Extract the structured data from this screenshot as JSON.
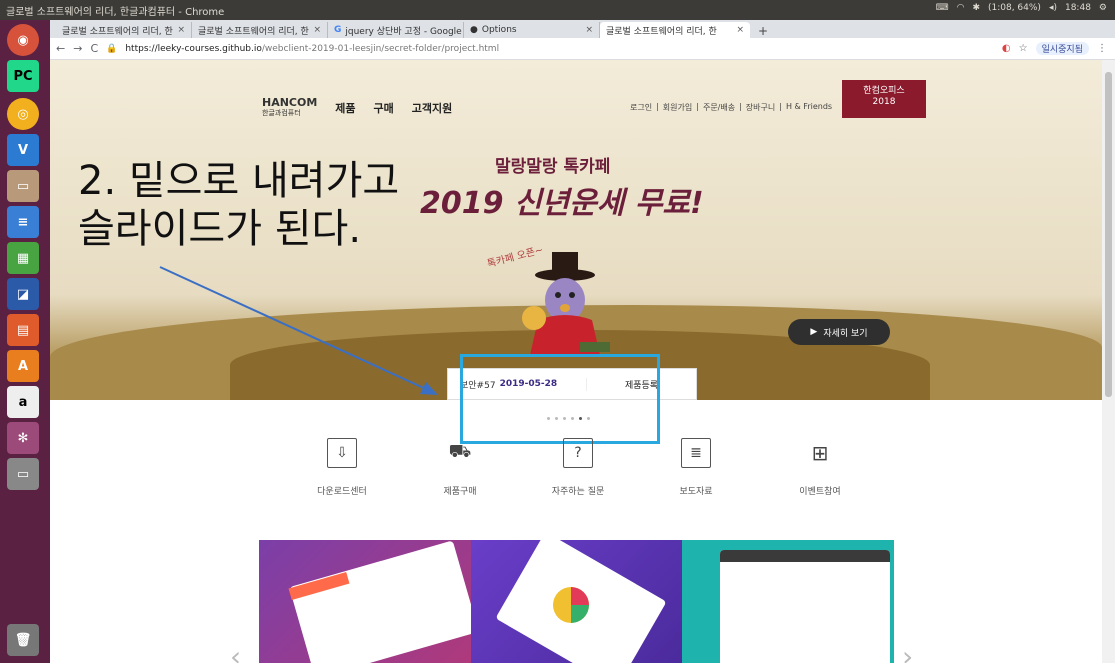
{
  "window_title": "글로벌 소프트웨어의 리더, 한글과컴퓨터 - Chrome",
  "system_status": "(1:08, 64%)",
  "clock": "18:48",
  "launcher_items": [
    "ubuntu-logo",
    "pycharm",
    "chrome",
    "vscode",
    "files",
    "writer",
    "calc",
    "photos",
    "impress",
    "software-center",
    "amazon",
    "settings",
    "drive",
    "trash"
  ],
  "tabs": [
    {
      "label": "글로벌 소프트웨어의 리더, 한",
      "active": false
    },
    {
      "label": "글로벌 소프트웨어의 리더, 한",
      "active": false
    },
    {
      "label": "jquery 상단바 고정 - Google",
      "active": false
    },
    {
      "label": "Options",
      "active": false
    },
    {
      "label": "글로벌 소프트웨어의 리더, 한",
      "active": true
    }
  ],
  "new_tab": "+",
  "url": {
    "host": "https://leeky-courses.github.io",
    "path": "/webclient-2019-01-leesjin/secret-folder/project.html"
  },
  "user_chip": "일시중지됨",
  "site": {
    "logo": "HANCOM",
    "logo_sub": "한글과컴퓨터",
    "nav": [
      "제품",
      "구매",
      "고객지원"
    ],
    "util": [
      "로그인",
      "회원가입",
      "주문/배송",
      "장바구니",
      "H & Friends"
    ],
    "hanoffice_line1": "한컴오피스",
    "hanoffice_line2": "2018"
  },
  "hero": {
    "promo_small": "말랑말랑 톡카페",
    "promo_big": "2019 신년운세 무료!",
    "promo_tag": "톡카페 오픈~",
    "detail_button": "자세히 보기",
    "detail_icon": "play-icon"
  },
  "reg_box": {
    "security": "보안#57",
    "date": "2019-05-28",
    "register": "제품등록"
  },
  "slide_dots": {
    "count": 6,
    "active_index": 4
  },
  "annotation": "2. 밑으로 내려가고\n슬라이드가 된다.",
  "quick_links": [
    {
      "label": "다운로드센터",
      "icon": "download-icon",
      "glyph": "⇩"
    },
    {
      "label": "제품구매",
      "icon": "cart-icon",
      "glyph": "🛒"
    },
    {
      "label": "자주하는 질문",
      "icon": "question-icon",
      "glyph": "?"
    },
    {
      "label": "보도자료",
      "icon": "news-icon",
      "glyph": "≣"
    },
    {
      "label": "이벤트참여",
      "icon": "gift-icon",
      "glyph": "⊞"
    }
  ],
  "colors": {
    "annot_box": "#29a8df",
    "arrow": "#3b6fc4",
    "hanoffice_bg": "#8b1a2c"
  }
}
